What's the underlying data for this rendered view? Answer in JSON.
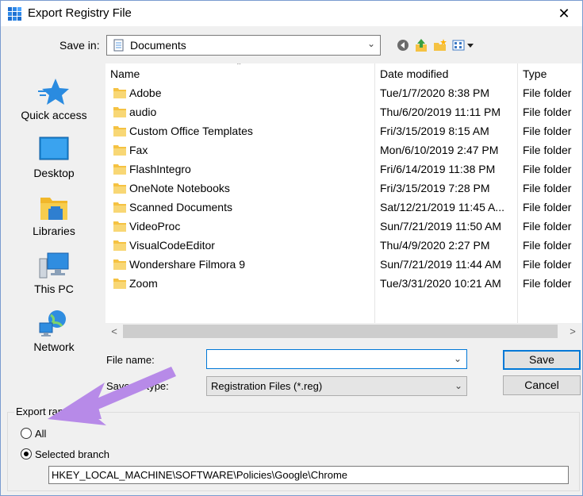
{
  "window": {
    "title": "Export Registry File",
    "close_glyph": "✕"
  },
  "toolbar": {
    "save_in_label": "Save in:",
    "save_in_value": "Documents",
    "back_icon": "back-icon",
    "up_icon": "up-folder-icon",
    "new_folder_icon": "new-folder-icon",
    "views_icon": "views-menu-icon"
  },
  "places": [
    {
      "label": "Quick access",
      "icon": "quick-access-star-icon"
    },
    {
      "label": "Desktop",
      "icon": "desktop-icon"
    },
    {
      "label": "Libraries",
      "icon": "libraries-icon"
    },
    {
      "label": "This PC",
      "icon": "this-pc-icon"
    },
    {
      "label": "Network",
      "icon": "network-icon"
    }
  ],
  "columns": {
    "name": "Name",
    "date": "Date modified",
    "type": "Type"
  },
  "files": [
    {
      "name": "Adobe",
      "date": "Tue/1/7/2020 8:38 PM",
      "type": "File folder"
    },
    {
      "name": "audio",
      "date": "Thu/6/20/2019 11:11 PM",
      "type": "File folder"
    },
    {
      "name": "Custom Office Templates",
      "date": "Fri/3/15/2019 8:15 AM",
      "type": "File folder"
    },
    {
      "name": "Fax",
      "date": "Mon/6/10/2019 2:47 PM",
      "type": "File folder"
    },
    {
      "name": "FlashIntegro",
      "date": "Fri/6/14/2019 11:38 PM",
      "type": "File folder"
    },
    {
      "name": "OneNote Notebooks",
      "date": "Fri/3/15/2019 7:28 PM",
      "type": "File folder"
    },
    {
      "name": "Scanned Documents",
      "date": "Sat/12/21/2019 11:45 A...",
      "type": "File folder"
    },
    {
      "name": "VideoProc",
      "date": "Sun/7/21/2019 11:50 AM",
      "type": "File folder"
    },
    {
      "name": "VisualCodeEditor",
      "date": "Thu/4/9/2020 2:27 PM",
      "type": "File folder"
    },
    {
      "name": "Wondershare Filmora 9",
      "date": "Sun/7/21/2019 11:44 AM",
      "type": "File folder"
    },
    {
      "name": "Zoom",
      "date": "Tue/3/31/2020 10:21 AM",
      "type": "File folder"
    }
  ],
  "scroll": {
    "left": "<",
    "right": ">"
  },
  "form": {
    "file_name_label": "File name:",
    "file_name_value": "",
    "save_as_type_label": "Save as type:",
    "save_as_type_value": "Registration Files (*.reg)",
    "save_button": "Save",
    "cancel_button": "Cancel"
  },
  "export": {
    "group_label": "Export range",
    "all_label": "All",
    "selected_label": "Selected branch",
    "branch_value": "HKEY_LOCAL_MACHINE\\SOFTWARE\\Policies\\Google\\Chrome"
  },
  "colors": {
    "accent": "#0078d7",
    "arrow": "#b78ae8",
    "folder": "#f5c242"
  }
}
